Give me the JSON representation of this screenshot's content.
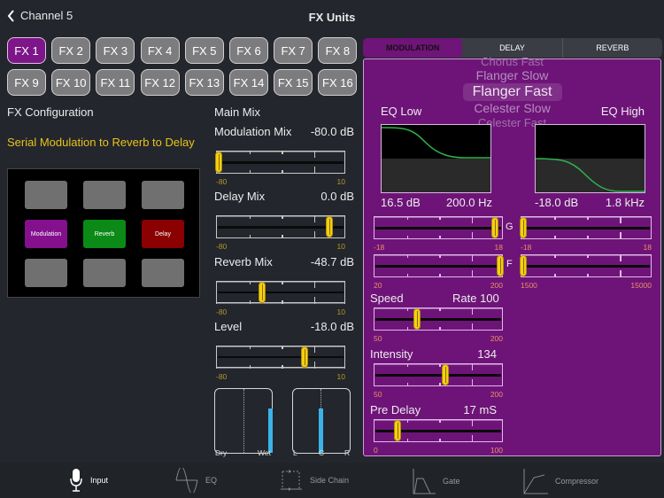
{
  "header": {
    "back_label": "Channel 5",
    "title": "FX Units"
  },
  "fx_buttons": [
    "FX 1",
    "FX 2",
    "FX 3",
    "FX 4",
    "FX 5",
    "FX 6",
    "FX 7",
    "FX 8",
    "FX 9",
    "FX 10",
    "FX 11",
    "FX 12",
    "FX 13",
    "FX 14",
    "FX 15",
    "FX 16"
  ],
  "selected_fx": "FX 1",
  "config": {
    "title": "FX Configuration",
    "description": "Serial Modulation to Reverb to Delay",
    "cells": [
      "",
      "",
      "",
      "Modulation",
      "Reverb",
      "Delay",
      "",
      "",
      ""
    ]
  },
  "colors": {
    "modulation": "#84108e",
    "reverb": "#0b8a17",
    "delay": "#8b0000",
    "accent": "#f5cf15",
    "panel": "#6e1478"
  },
  "main_mix": {
    "title": "Main Mix",
    "sliders": [
      {
        "label": "Modulation Mix",
        "value": "-80.0 dB",
        "min": "-80",
        "max": "10",
        "fraction": 0.0
      },
      {
        "label": "Delay Mix",
        "value": "0.0 dB",
        "min": "-80",
        "max": "10",
        "fraction": 0.89
      },
      {
        "label": "Reverb Mix",
        "value": "-48.7 dB",
        "min": "-80",
        "max": "10",
        "fraction": 0.35
      },
      {
        "label": "Level",
        "value": "-18.0 dB",
        "min": "-80",
        "max": "10",
        "fraction": 0.69
      }
    ],
    "meters": {
      "dry": "Dry",
      "wet": "Wet",
      "wet_level": 0.68,
      "left": "L",
      "center": "C",
      "right": "R",
      "pan_level": 0.68
    }
  },
  "tabs": [
    "MODULATION",
    "DELAY",
    "REVERB"
  ],
  "picker": {
    "items": [
      "Chorus Fast",
      "Flanger Slow",
      "Flanger Fast",
      "Celester Slow",
      "Celester Fast"
    ],
    "selected": "Flanger Fast"
  },
  "eq": {
    "low": {
      "title": "EQ Low",
      "gain": "16.5 dB",
      "freq": "200.0 Hz"
    },
    "high": {
      "title": "EQ High",
      "gain": "-18.0 dB",
      "freq": "1.8 kHz"
    },
    "g_label": "G",
    "f_label": "F",
    "sliders": {
      "low_gain": {
        "min": "-18",
        "max": "18",
        "fraction": 0.96
      },
      "high_gain": {
        "min": "-18",
        "max": "18",
        "fraction": 0.0
      },
      "low_freq": {
        "min": "20",
        "max": "200",
        "fraction": 1.0
      },
      "high_freq": {
        "min": "1500",
        "max": "15000",
        "fraction": 0.0
      }
    }
  },
  "mod_params": [
    {
      "label": "Speed",
      "value": "Rate 100",
      "min": "50",
      "max": "200",
      "fraction": 0.33
    },
    {
      "label": "Intensity",
      "value": "134",
      "min": "50",
      "max": "200",
      "fraction": 0.56
    },
    {
      "label": "Pre Delay",
      "value": "17 mS",
      "min": "0",
      "max": "100",
      "fraction": 0.17
    }
  ],
  "bottom_nav": [
    "Input",
    "EQ",
    "Side Chain",
    "Gate",
    "Compressor"
  ]
}
